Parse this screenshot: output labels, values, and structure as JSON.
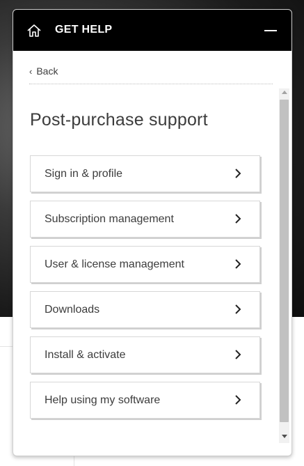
{
  "header": {
    "title": "GET HELP",
    "home_icon": "home-icon",
    "minimize_icon": "minimize-icon"
  },
  "navigation": {
    "back_label": "Back",
    "back_icon": "chevron-left-icon"
  },
  "page": {
    "title": "Post-purchase support"
  },
  "options": [
    {
      "label": "Sign in & profile"
    },
    {
      "label": "Subscription management"
    },
    {
      "label": "User & license management"
    },
    {
      "label": "Downloads"
    },
    {
      "label": "Install & activate"
    },
    {
      "label": "Help using my software"
    }
  ],
  "colors": {
    "header_bg": "#000000",
    "header_text": "#ffffff",
    "body_text": "#3c3c3c",
    "card_border": "#d7d7d7"
  }
}
